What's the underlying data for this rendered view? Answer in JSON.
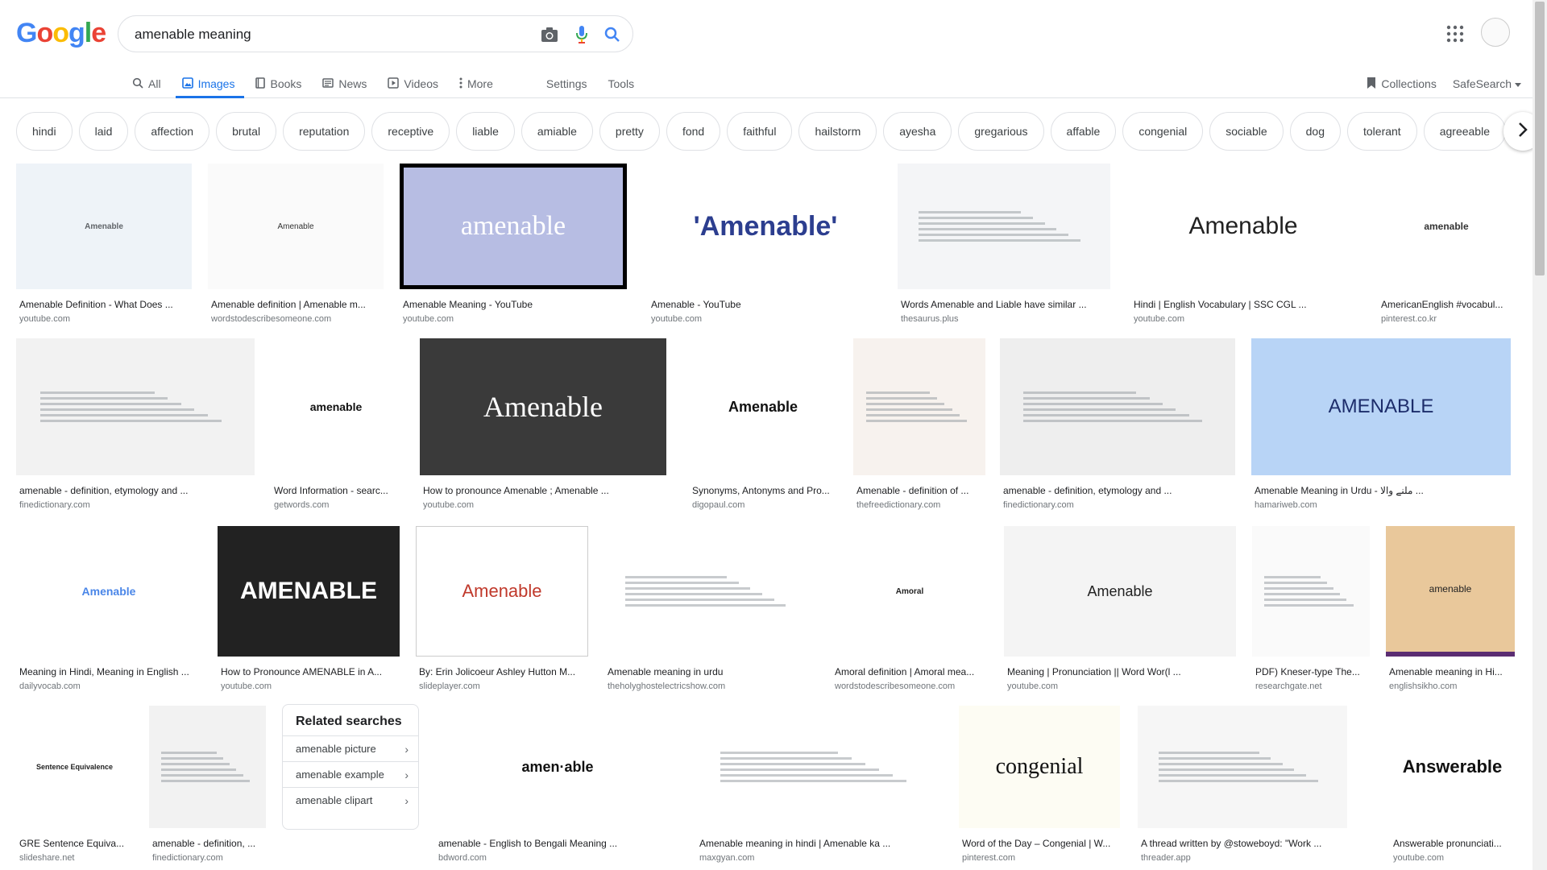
{
  "search": {
    "query": "amenable meaning"
  },
  "logo": "Google",
  "nav": {
    "all": "All",
    "images": "Images",
    "books": "Books",
    "news": "News",
    "videos": "Videos",
    "more": "More",
    "settings": "Settings",
    "tools": "Tools",
    "collections": "Collections",
    "safesearch": "SafeSearch"
  },
  "chips": [
    "hindi",
    "laid",
    "affection",
    "brutal",
    "reputation",
    "receptive",
    "liable",
    "amiable",
    "pretty",
    "fond",
    "faithful",
    "hailstorm",
    "ayesha",
    "gregarious",
    "affable",
    "congenial",
    "sociable",
    "dog",
    "tolerant",
    "agreeable"
  ],
  "results": [
    {
      "title": "Amenable Definition - What Does ...",
      "source": "youtube.com",
      "thumb": "Amenable"
    },
    {
      "title": "Amenable definition | Amenable m...",
      "source": "wordstodescribesomeone.com",
      "thumb": "Amenable"
    },
    {
      "title": "Amenable Meaning - YouTube",
      "source": "youtube.com",
      "thumb": "amenable"
    },
    {
      "title": "Amenable - YouTube",
      "source": "youtube.com",
      "thumb": "'Amenable'"
    },
    {
      "title": "Words Amenable and Liable have similar ...",
      "source": "thesaurus.plus",
      "thumb": ""
    },
    {
      "title": "Hindi | English Vocabulary | SSC CGL ...",
      "source": "youtube.com",
      "thumb": "Amenable"
    },
    {
      "title": "AmericanEnglish #vocabul...",
      "source": "pinterest.co.kr",
      "thumb": "amenable"
    },
    {
      "title": "amenable - definition, etymology and ...",
      "source": "finedictionary.com",
      "thumb": ""
    },
    {
      "title": "Word Information - searc...",
      "source": "getwords.com",
      "thumb": "amenable"
    },
    {
      "title": "How to pronounce Amenable ; Amenable ...",
      "source": "youtube.com",
      "thumb": "Amenable"
    },
    {
      "title": "Synonyms, Antonyms and Pro...",
      "source": "digopaul.com",
      "thumb": "Amenable"
    },
    {
      "title": "Amenable - definition of ...",
      "source": "thefreedictionary.com",
      "thumb": ""
    },
    {
      "title": "amenable - definition, etymology and ...",
      "source": "finedictionary.com",
      "thumb": ""
    },
    {
      "title": "Amenable Meaning in Urdu - ملنے والا ...",
      "source": "hamariweb.com",
      "thumb": "AMENABLE"
    },
    {
      "title": "Meaning in Hindi, Meaning in English ...",
      "source": "dailyvocab.com",
      "thumb": "Amenable"
    },
    {
      "title": "How to Pronounce AMENABLE in A...",
      "source": "youtube.com",
      "thumb": "AMENABLE"
    },
    {
      "title": "By: Erin Jolicoeur Ashley Hutton M...",
      "source": "slideplayer.com",
      "thumb": "Amenable"
    },
    {
      "title": "Amenable meaning in urdu",
      "source": "theholyghostelectricshow.com",
      "thumb": ""
    },
    {
      "title": "Amoral definition | Amoral mea...",
      "source": "wordstodescribesomeone.com",
      "thumb": "Amoral"
    },
    {
      "title": "Meaning | Pronunciation || Word Wor(l ...",
      "source": "youtube.com",
      "thumb": "Amenable"
    },
    {
      "title": "PDF) Kneser-type The...",
      "source": "researchgate.net",
      "thumb": ""
    },
    {
      "title": "Amenable meaning in Hi...",
      "source": "englishsikho.com",
      "thumb": "amenable"
    },
    {
      "title": "GRE Sentence Equiva...",
      "source": "slideshare.net",
      "thumb": "Sentence Equivalence"
    },
    {
      "title": "amenable - definition, ...",
      "source": "finedictionary.com",
      "thumb": ""
    },
    {
      "title": "amenable - English to Bengali Meaning ...",
      "source": "bdword.com",
      "thumb": "amen·able"
    },
    {
      "title": "Amenable meaning in hindi | Amenable ka ...",
      "source": "maxgyan.com",
      "thumb": ""
    },
    {
      "title": "Word of the Day – Congenial | W...",
      "source": "pinterest.com",
      "thumb": "congenial"
    },
    {
      "title": "A thread written by @stoweboyd: \"Work ...",
      "source": "threader.app",
      "thumb": ""
    },
    {
      "title": "Answerable pronunciati...",
      "source": "youtube.com",
      "thumb": "Answerable"
    }
  ],
  "related": {
    "title": "Related searches",
    "items": [
      "amenable picture",
      "amenable example",
      "amenable clipart"
    ]
  },
  "colors": {
    "accent": "#1a73e8"
  }
}
